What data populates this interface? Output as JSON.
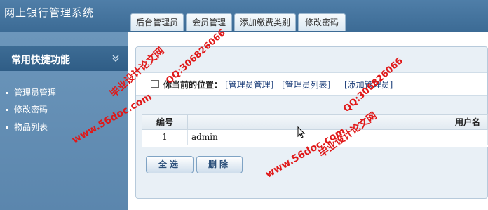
{
  "app": {
    "title": "网上银行管理系统"
  },
  "tabs": [
    {
      "label": "后台管理员"
    },
    {
      "label": "会员管理"
    },
    {
      "label": "添加缴费类别"
    },
    {
      "label": "修改密码"
    }
  ],
  "sidebar": {
    "title": "常用快捷功能",
    "items": [
      {
        "label": "管理员管理"
      },
      {
        "label": "修改密码"
      },
      {
        "label": "物品列表"
      }
    ]
  },
  "breadcrumb": {
    "label": "你当前的位置：",
    "crumb1": "[管理员管理]",
    "sep": "-",
    "crumb2": "[管理员列表]",
    "add_link": "[添加管理员]"
  },
  "table": {
    "headers": [
      "编号",
      "用户名"
    ],
    "rows": [
      [
        "1",
        "admin"
      ]
    ]
  },
  "buttons": {
    "select_all": "全选",
    "delete": "删除"
  },
  "watermarks": {
    "site": "www.56doc.com",
    "qq": "QQ:306826066",
    "name": "毕业设计论文网"
  },
  "colors": {
    "accent": "#3c6b95",
    "watermark": "#e01818"
  },
  "icons": {
    "collapse": "chevron-down-icon",
    "crumb": "checkbox-icon"
  }
}
